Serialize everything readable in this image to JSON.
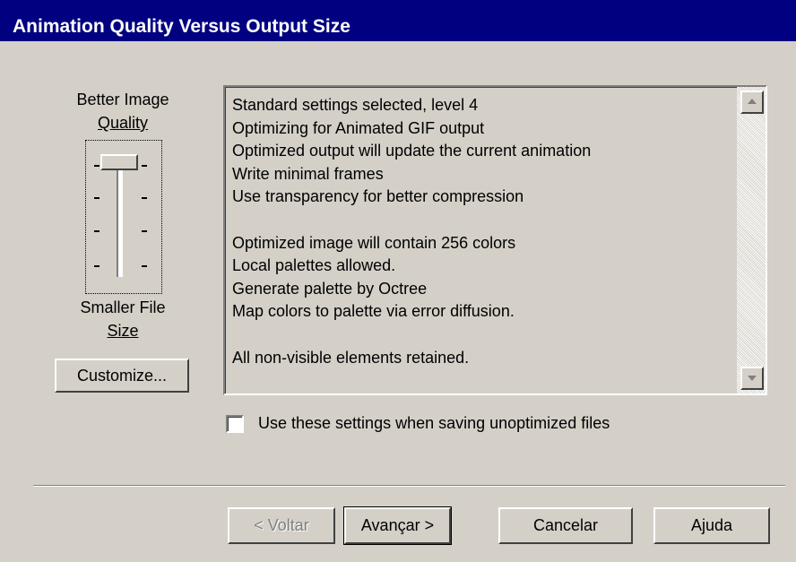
{
  "window": {
    "title": "Animation Quality Versus Output Size"
  },
  "slider": {
    "top_label_line1": "Better Image",
    "top_label_line2": "Quality",
    "bottom_label_line1": "Smaller File",
    "bottom_label_line2": "Size",
    "level": 4
  },
  "customize_button": {
    "label": "Customize..."
  },
  "settings_text": {
    "lines": [
      "Standard settings selected, level 4",
      "Optimizing for Animated GIF output",
      "Optimized output will update the current animation",
      "Write minimal frames",
      "Use transparency for better compression",
      "",
      "Optimized image will contain 256 colors",
      "Local palettes allowed.",
      "Generate palette by Octree",
      "Map colors to palette via error diffusion.",
      "",
      "All non-visible elements retained."
    ]
  },
  "checkbox": {
    "label": "Use these settings when saving unoptimized files",
    "checked": false
  },
  "footer": {
    "back_label": "< Voltar",
    "next_label": "Avançar >",
    "cancel_label": "Cancelar",
    "help_label": "Ajuda"
  },
  "colors": {
    "titlebar": "#000080",
    "face": "#d4d0c8"
  }
}
